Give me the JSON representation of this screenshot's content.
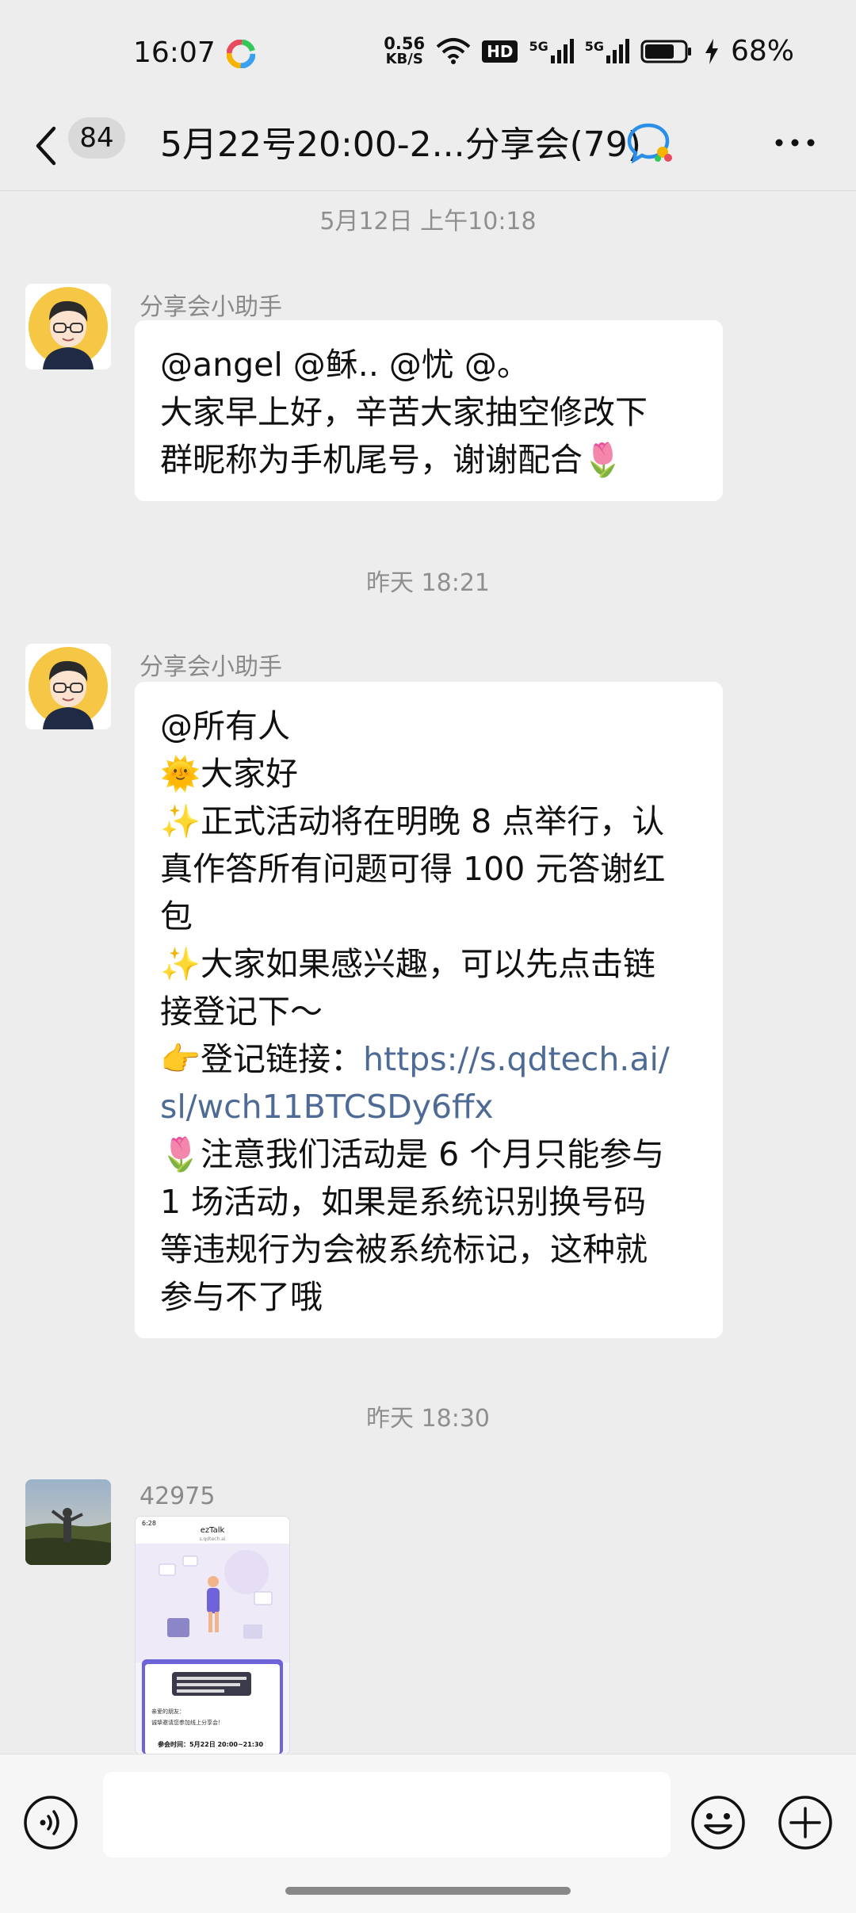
{
  "status_bar": {
    "time": "16:07",
    "net_speed_value": "0.56",
    "net_speed_unit": "KB/S",
    "hd_label": "HD",
    "sim1_label": "5G",
    "sim2_label": "5G",
    "battery_pct": "68%",
    "icons": [
      "app-notification-icon",
      "wifi-icon",
      "hd-icon",
      "signal-icon",
      "signal-icon",
      "battery-icon",
      "charging-icon"
    ]
  },
  "header": {
    "unread_count": "84",
    "title": "5月22号20:00-2...分享会(79)",
    "icons": [
      "back-icon",
      "group-chat-icon",
      "more-icon"
    ]
  },
  "messages": [
    {
      "timestamp": "5月12日 上午10:18",
      "sender": "分享会小助手",
      "lines": [
        "@angel @稣.. @忧 @。",
        "大家早上好，辛苦大家抽空修改下",
        "群昵称为手机尾号，谢谢配合🌷"
      ]
    },
    {
      "timestamp": "昨天 18:21",
      "sender": "分享会小助手",
      "lines": [
        "@所有人",
        "🌞大家好",
        "✨正式活动将在明晚 8 点举行，认",
        "真作答所有问题可得 100 元答谢红",
        "包",
        "✨大家如果感兴趣，可以先点击链",
        "接登记下～"
      ],
      "link_prefix": "👉登记链接：",
      "link_line1": "https://s.qdtech.ai/",
      "link_line2": "sl/wch11BTCSDy6ffx",
      "tail_lines": [
        "🌷注意我们活动是 6 个月只能参与",
        "1 场活动，如果是系统识别换号码",
        "等违规行为会被系统标记，这种就",
        "参与不了哦"
      ]
    },
    {
      "timestamp": "昨天 18:30",
      "sender": "42975",
      "image": {
        "app_name": "ezTalk",
        "app_sub": "s.qdtech.ai",
        "time": "6:28",
        "text_a": "亲爱的朋友：",
        "text_b": "诚挚邀请您参加线上分享会！",
        "text_c": "参会时间：5月22日 20:00~21:30"
      }
    }
  ],
  "input_bar": {
    "placeholder": "",
    "icons": [
      "voice-icon",
      "emoji-icon",
      "plus-icon"
    ]
  }
}
